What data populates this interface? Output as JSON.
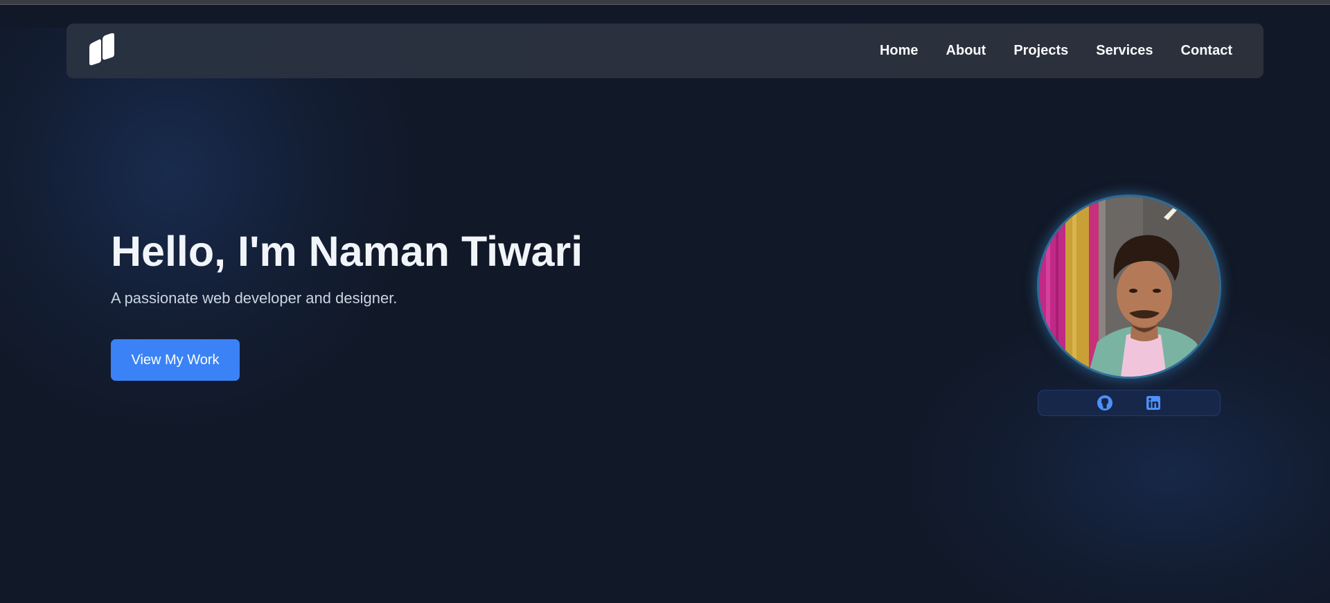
{
  "nav": {
    "logo_icon": "two-slanted-bars-logo-icon",
    "links": [
      "Home",
      "About",
      "Projects",
      "Services",
      "Contact"
    ]
  },
  "hero": {
    "title": "Hello, I'm Naman Tiwari",
    "subtitle": "A passionate web developer and designer.",
    "cta_label": "View My Work"
  },
  "profile": {
    "photo": "profile-photo"
  },
  "social": {
    "icons": [
      "github-icon",
      "linkedin-icon"
    ]
  },
  "colors": {
    "background": "#111827",
    "navbar": "#2a303d",
    "accent": "#3b82f6",
    "social_icon": "#4f8ff7"
  }
}
